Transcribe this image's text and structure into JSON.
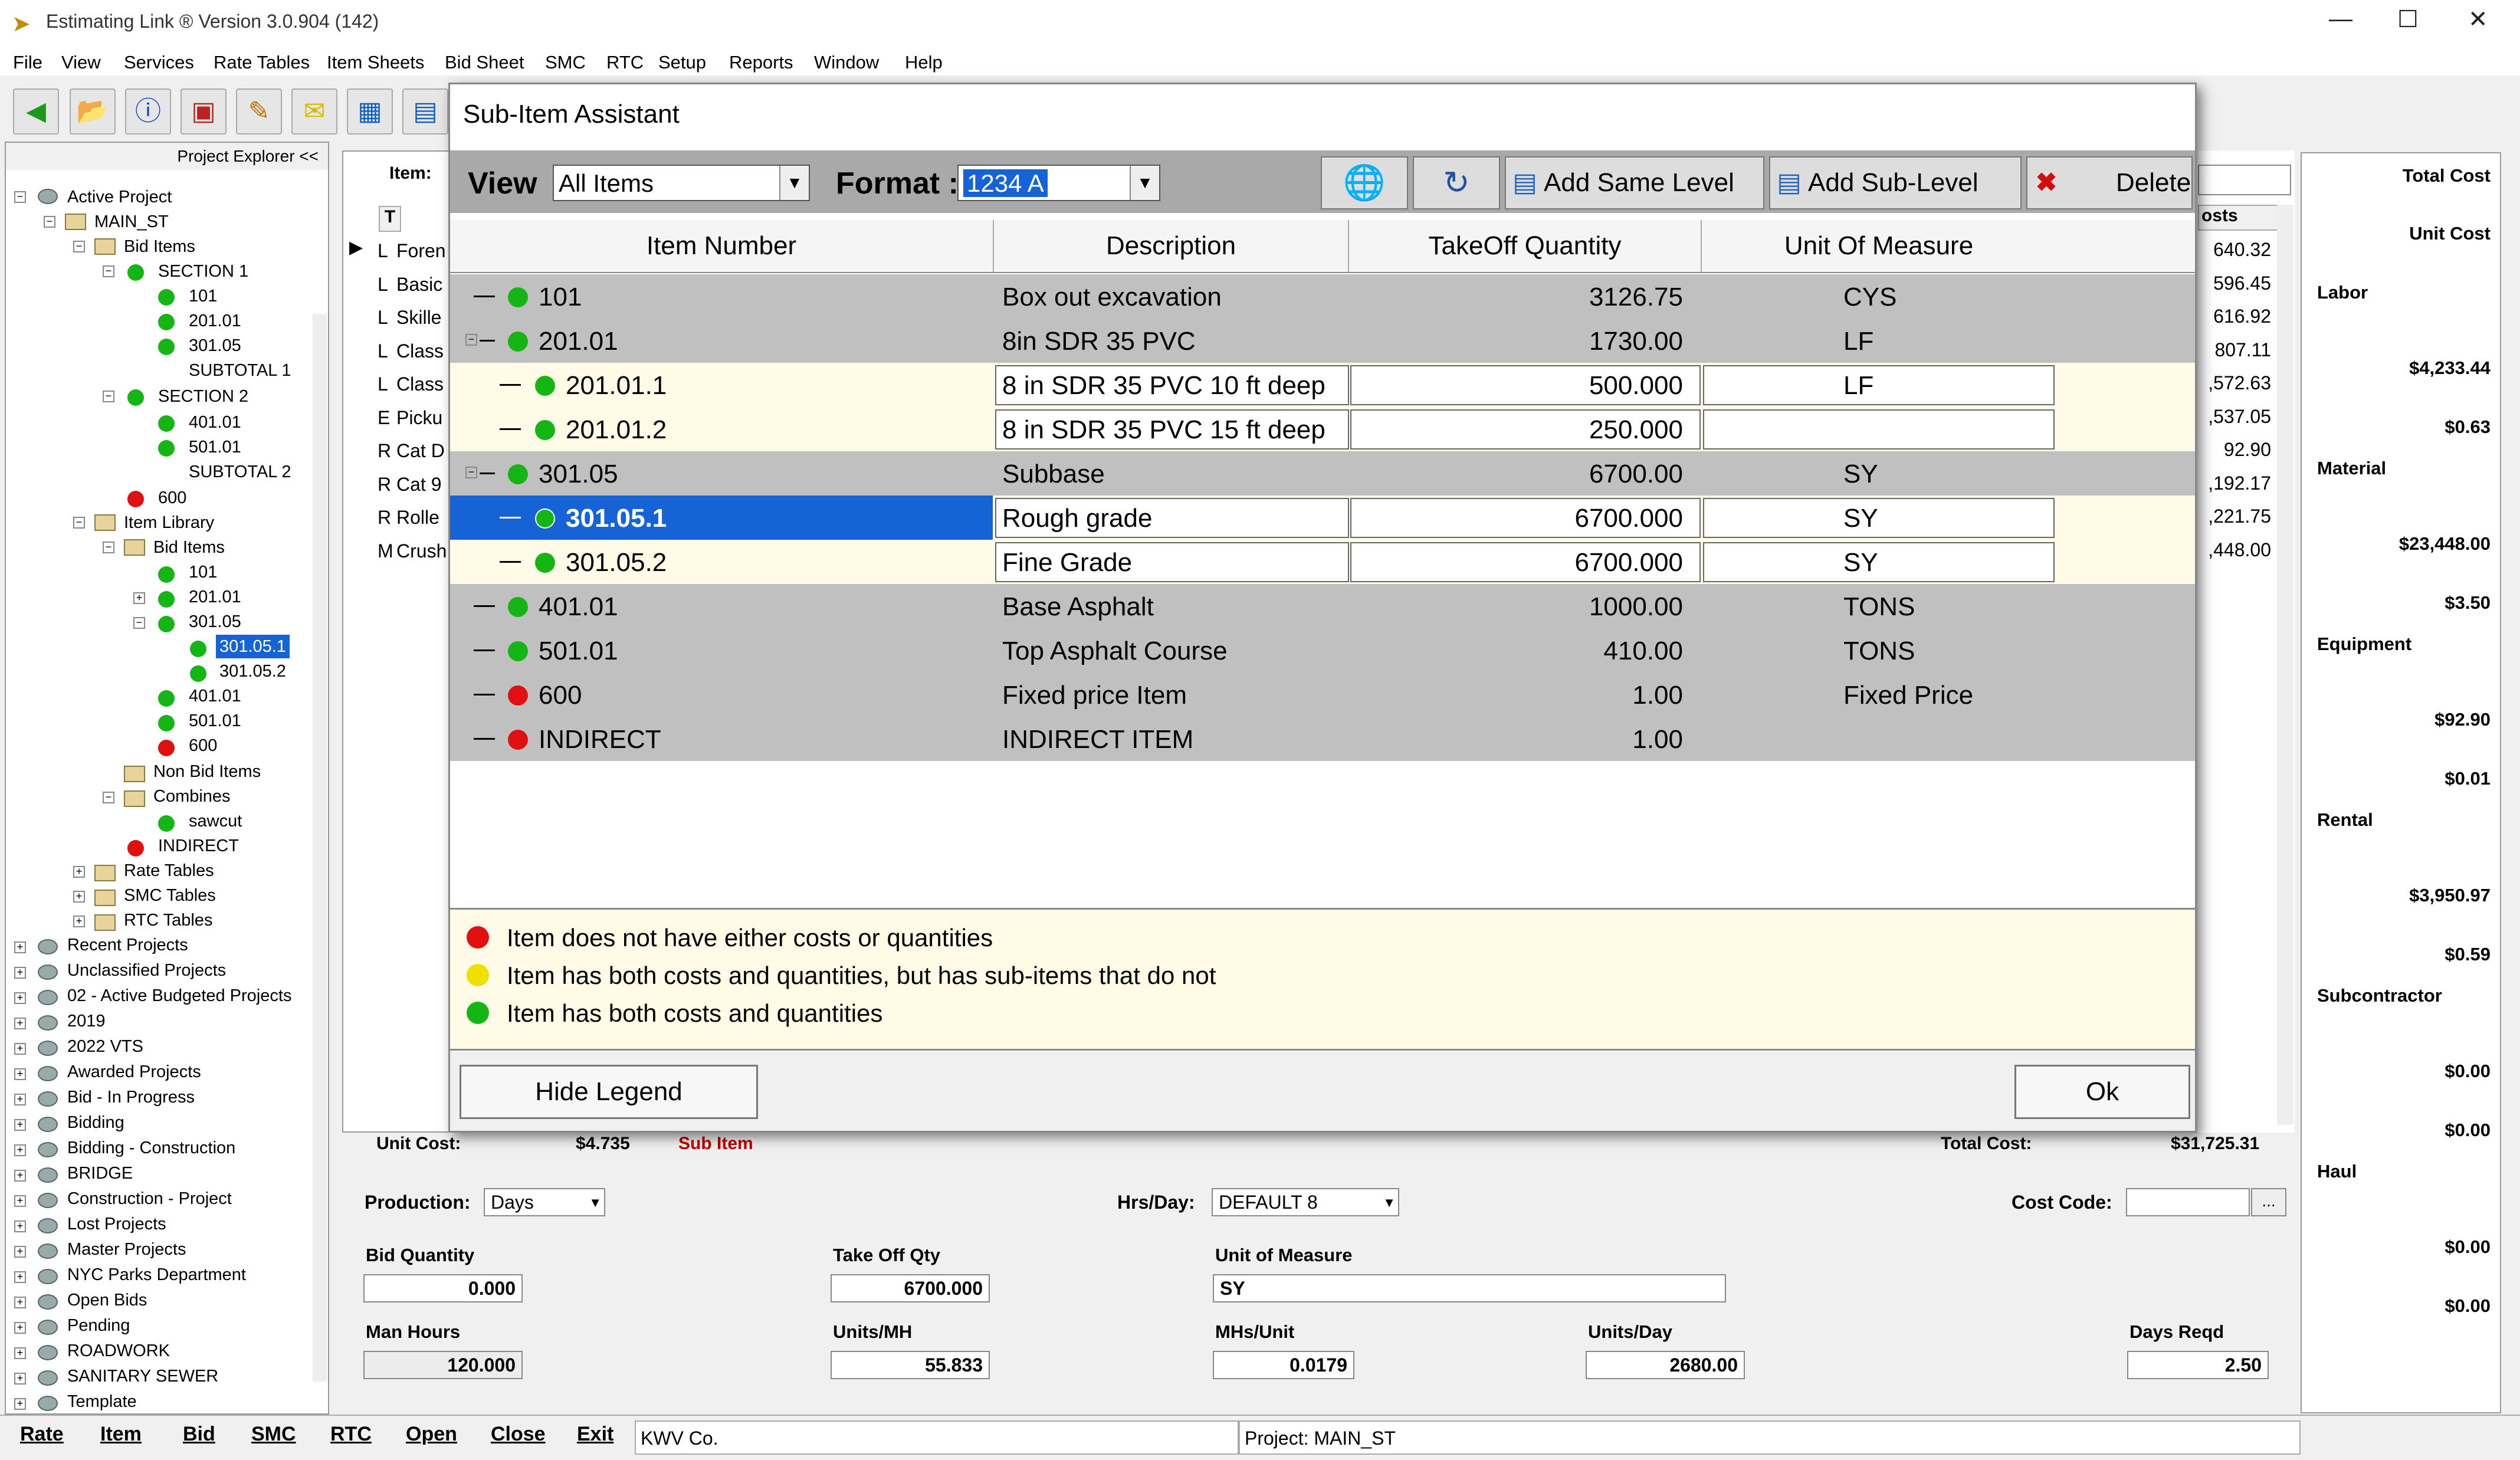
{
  "window": {
    "title": "Estimating Link ® Version   3.0.904 (142)",
    "controls": [
      "—",
      "☐",
      "✕"
    ]
  },
  "menu": [
    "File",
    "View",
    "Services",
    "Rate Tables",
    "Item Sheets",
    "Bid Sheet",
    "SMC",
    "RTC",
    "Setup",
    "Reports",
    "Window",
    "Help"
  ],
  "explorer": {
    "header": "Project Explorer <<",
    "tree": {
      "active_project": "Active Project",
      "main_st": "MAIN_ST",
      "bid_items": "Bid Items",
      "section1": "SECTION 1",
      "i101": "101",
      "i20101": "201.01",
      "i30105": "301.05",
      "subtotal1": "SUBTOTAL 1",
      "section2": "SECTION 2",
      "i40101": "401.01",
      "i50101": "501.01",
      "subtotal2": "SUBTOTAL 2",
      "i600": "600",
      "item_library": "Item Library",
      "lib_bid_items": "Bid Items",
      "l101": "101",
      "l20101": "201.01",
      "l30105": "301.05",
      "l301051": "301.05.1",
      "l301052": "301.05.2",
      "l40101": "401.01",
      "l50101": "501.01",
      "l600": "600",
      "non_bid": "Non Bid Items",
      "combines": "Combines",
      "sawcut": "sawcut",
      "indirect": "INDIRECT",
      "rate_tables": "Rate Tables",
      "smc_tables": "SMC Tables",
      "rtc_tables": "RTC Tables"
    },
    "groups": [
      "Recent Projects",
      "Unclassified Projects",
      "02 - Active Budgeted Projects",
      "2019",
      "2022 VTS",
      "Awarded Projects",
      "Bid - In Progress",
      "Bidding",
      "Bidding - Construction",
      "BRIDGE",
      "Construction - Project",
      "Lost Projects",
      "Master Projects",
      "NYC Parks Department",
      "Open Bids",
      "Pending",
      "ROADWORK",
      "SANITARY SEWER",
      "Template"
    ]
  },
  "grid": {
    "item_label": "Item:",
    "t_header": "T",
    "types": [
      "L",
      "L",
      "L",
      "L",
      "L",
      "E",
      "R",
      "R",
      "R",
      "M"
    ],
    "names": [
      "Foren",
      "Basic",
      "Skille",
      "Class",
      "Class",
      "Picku",
      "Cat D",
      "Cat 9",
      "Rolle",
      "Crush"
    ],
    "costs_header": "osts",
    "costs": [
      "640.32",
      "596.45",
      "616.92",
      "807.11",
      ",572.63",
      ",537.05",
      "92.90",
      ",192.17",
      ",221.75",
      ",448.00"
    ]
  },
  "right_panel": {
    "total_cost": "Total Cost",
    "unit_cost": "Unit Cost",
    "labor": "Labor",
    "labor_total": "$4,233.44",
    "labor_unit": "$0.63",
    "material": "Material",
    "material_total": "$23,448.00",
    "material_unit": "$3.50",
    "equipment": "Equipment",
    "equipment_total": "$92.90",
    "equipment_unit": "$0.01",
    "rental": "Rental",
    "rental_total": "$3,950.97",
    "rental_unit": "$0.59",
    "subcontractor": "Subcontractor",
    "sub_total": "$0.00",
    "sub_unit": "$0.00",
    "haul": "Haul",
    "haul_total": "$0.00",
    "haul_unit": "$0.00"
  },
  "form": {
    "unit_cost_label": "Unit Cost:",
    "unit_cost": "$4.735",
    "sub_item": "Sub Item",
    "total_cost_label": "Total Cost:",
    "total_cost": "$31,725.31",
    "production_label": "Production:",
    "production": "Days",
    "hrs_day_label": "Hrs/Day:",
    "hrs_day": "DEFAULT  8",
    "cost_code_label": "Cost Code:",
    "cost_code": "",
    "cost_code_btn": "...",
    "bid_qty_label": "Bid Quantity",
    "bid_qty": "0.000",
    "takeoff_label": "Take Off Qty",
    "takeoff": "6700.000",
    "uom_label": "Unit of Measure",
    "uom": "SY",
    "man_hours_label": "Man Hours",
    "man_hours": "120.000",
    "units_mh_label": "Units/MH",
    "units_mh": "55.833",
    "mhs_unit_label": "MHs/Unit",
    "mhs_unit": "0.0179",
    "units_day_label": "Units/Day",
    "units_day": "2680.00",
    "days_reqd_label": "Days Reqd",
    "days_reqd": "2.50"
  },
  "status": {
    "buttons": [
      "Rate",
      "Item",
      "Bid",
      "SMC",
      "RTC",
      "Open",
      "Close",
      "Exit"
    ],
    "company": "KWV Co.",
    "project": "Project: MAIN_ST"
  },
  "dialog": {
    "title": "Sub-Item Assistant",
    "view_label": "View",
    "view_value": "All Items",
    "format_label": "Format :",
    "format_value": "1234 A",
    "add_same": "Add Same Level",
    "add_sub": "Add Sub-Level",
    "delete": "Delete",
    "columns": [
      "Item Number",
      "Description",
      "TakeOff Quantity",
      "Unit Of Measure"
    ],
    "rows": [
      {
        "num": "101",
        "desc": "Box out excavation",
        "qty": "3126.75",
        "uom": "CYS",
        "status": "green"
      },
      {
        "num": "201.01",
        "desc": "8in SDR 35 PVC",
        "qty": "1730.00",
        "uom": "LF",
        "status": "green"
      },
      {
        "num": "201.01.1",
        "desc": "8 in SDR 35 PVC 10 ft deep",
        "qty": "500.000",
        "uom": "LF",
        "status": "green"
      },
      {
        "num": "201.01.2",
        "desc": "8 in SDR 35 PVC 15 ft deep",
        "qty": "250.000",
        "uom": "",
        "status": "green"
      },
      {
        "num": "301.05",
        "desc": "Subbase",
        "qty": "6700.00",
        "uom": "SY",
        "status": "green"
      },
      {
        "num": "301.05.1",
        "desc": "Rough grade",
        "qty": "6700.000",
        "uom": "SY",
        "status": "green"
      },
      {
        "num": "301.05.2",
        "desc": "Fine Grade",
        "qty": "6700.000",
        "uom": "SY",
        "status": "green"
      },
      {
        "num": "401.01",
        "desc": "Base Asphalt",
        "qty": "1000.00",
        "uom": "TONS",
        "status": "green"
      },
      {
        "num": "501.01",
        "desc": "Top Asphalt Course",
        "qty": "410.00",
        "uom": "TONS",
        "status": "green"
      },
      {
        "num": "600",
        "desc": "Fixed price Item",
        "qty": "1.00",
        "uom": "Fixed Price",
        "status": "red"
      },
      {
        "num": "INDIRECT",
        "desc": "INDIRECT ITEM",
        "qty": "1.00",
        "uom": "",
        "status": "red"
      }
    ],
    "legend": [
      "Item does not have either costs or quantities",
      "Item has both costs and quantities, but has sub-items that do not",
      "Item has both costs and quantities"
    ],
    "hide_legend": "Hide Legend",
    "ok": "Ok"
  },
  "colors": {
    "selection": "#1663d6",
    "green": "#15b515",
    "red": "#e01010",
    "yellow": "#f0e000",
    "legend_bg": "#fffbe6"
  }
}
